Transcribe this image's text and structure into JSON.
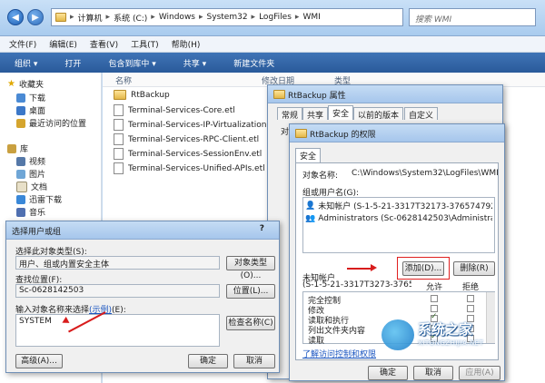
{
  "explorer": {
    "breadcrumb": [
      "计算机",
      "系统 (C:)",
      "Windows",
      "System32",
      "LogFiles",
      "WMI"
    ],
    "search_placeholder": "搜索 WMI",
    "menu": [
      "文件(F)",
      "编辑(E)",
      "查看(V)",
      "工具(T)",
      "帮助(H)"
    ],
    "toolbar": [
      "组织 ▾",
      "打开",
      "包含到库中 ▾",
      "共享 ▾",
      "新建文件夹"
    ],
    "sidebar": {
      "favorites": "收藏夹",
      "favorites_items": [
        "下载",
        "桌面",
        "最近访问的位置"
      ],
      "libraries": "库",
      "libraries_items": [
        "视频",
        "图片",
        "文档",
        "迅雷下载",
        "音乐"
      ]
    },
    "columns": [
      "名称",
      "修改日期",
      "类型"
    ],
    "files": [
      {
        "name": "RtBackup",
        "kind": "folder"
      },
      {
        "name": "Terminal-Services-Core.etl",
        "kind": "file"
      },
      {
        "name": "Terminal-Services-IP-Virtualization.etl",
        "kind": "file"
      },
      {
        "name": "Terminal-Services-RPC-Client.etl",
        "kind": "file"
      },
      {
        "name": "Terminal-Services-SessionEnv.etl",
        "kind": "file"
      },
      {
        "name": "Terminal-Services-Unified-APIs.etl",
        "kind": "file"
      }
    ]
  },
  "properties": {
    "title": "RtBackup 属性",
    "tabs": [
      "常规",
      "共享",
      "安全",
      "以前的版本",
      "自定义"
    ],
    "partial_label": "对象名"
  },
  "permissions": {
    "title": "RtBackup 的权限",
    "tab": "安全",
    "object_label": "对象名称:",
    "object_value": "C:\\Windows\\System32\\LogFiles\\WMI\\RtBacku",
    "group_label": "组或用户名(G):",
    "users": [
      "未知帐户 (S-1-5-21-3317T32173-376574792-267687",
      "Administrators (Sc-0628142503\\Administrators)"
    ],
    "add_button": "添加(D)...",
    "remove_button": "删除(R)",
    "perm_for_label": "未知帐户",
    "perm_for_sid": "(S-1-5-21-3317T3273-37657",
    "allow_header": "允许",
    "deny_header": "拒绝",
    "perms": [
      {
        "name": "完全控制",
        "allow": false,
        "deny": false
      },
      {
        "name": "修改",
        "allow": false,
        "deny": false
      },
      {
        "name": "读取和执行",
        "allow": true,
        "deny": false
      },
      {
        "name": "列出文件夹内容",
        "allow": true,
        "deny": false
      },
      {
        "name": "读取",
        "allow": true,
        "deny": false
      }
    ],
    "link": "了解访问控制和权限",
    "ok": "确定",
    "cancel": "取消",
    "apply": "应用(A)"
  },
  "select_user": {
    "title": "选择用户或组",
    "help_icon": "?",
    "type_label": "选择此对象类型(S):",
    "type_value": "用户、组或内置安全主体",
    "type_button": "对象类型(O)...",
    "location_label": "查找位置(F):",
    "location_value": "Sc-0628142503",
    "location_button": "位置(L)...",
    "enter_label": "输入对象名称来选择",
    "enter_link": "(示例)",
    "enter_suffix": "(E):",
    "enter_value": "SYSTEM",
    "check_button": "检查名称(C)",
    "advanced_button": "高级(A)...",
    "ok": "确定",
    "cancel": "取消"
  },
  "watermark": {
    "text": "系统之家",
    "url": "XITONGZHIJIA.NET"
  },
  "colors": {
    "arrow": "#d81c1c",
    "toolbar": "#2a5a9a"
  }
}
